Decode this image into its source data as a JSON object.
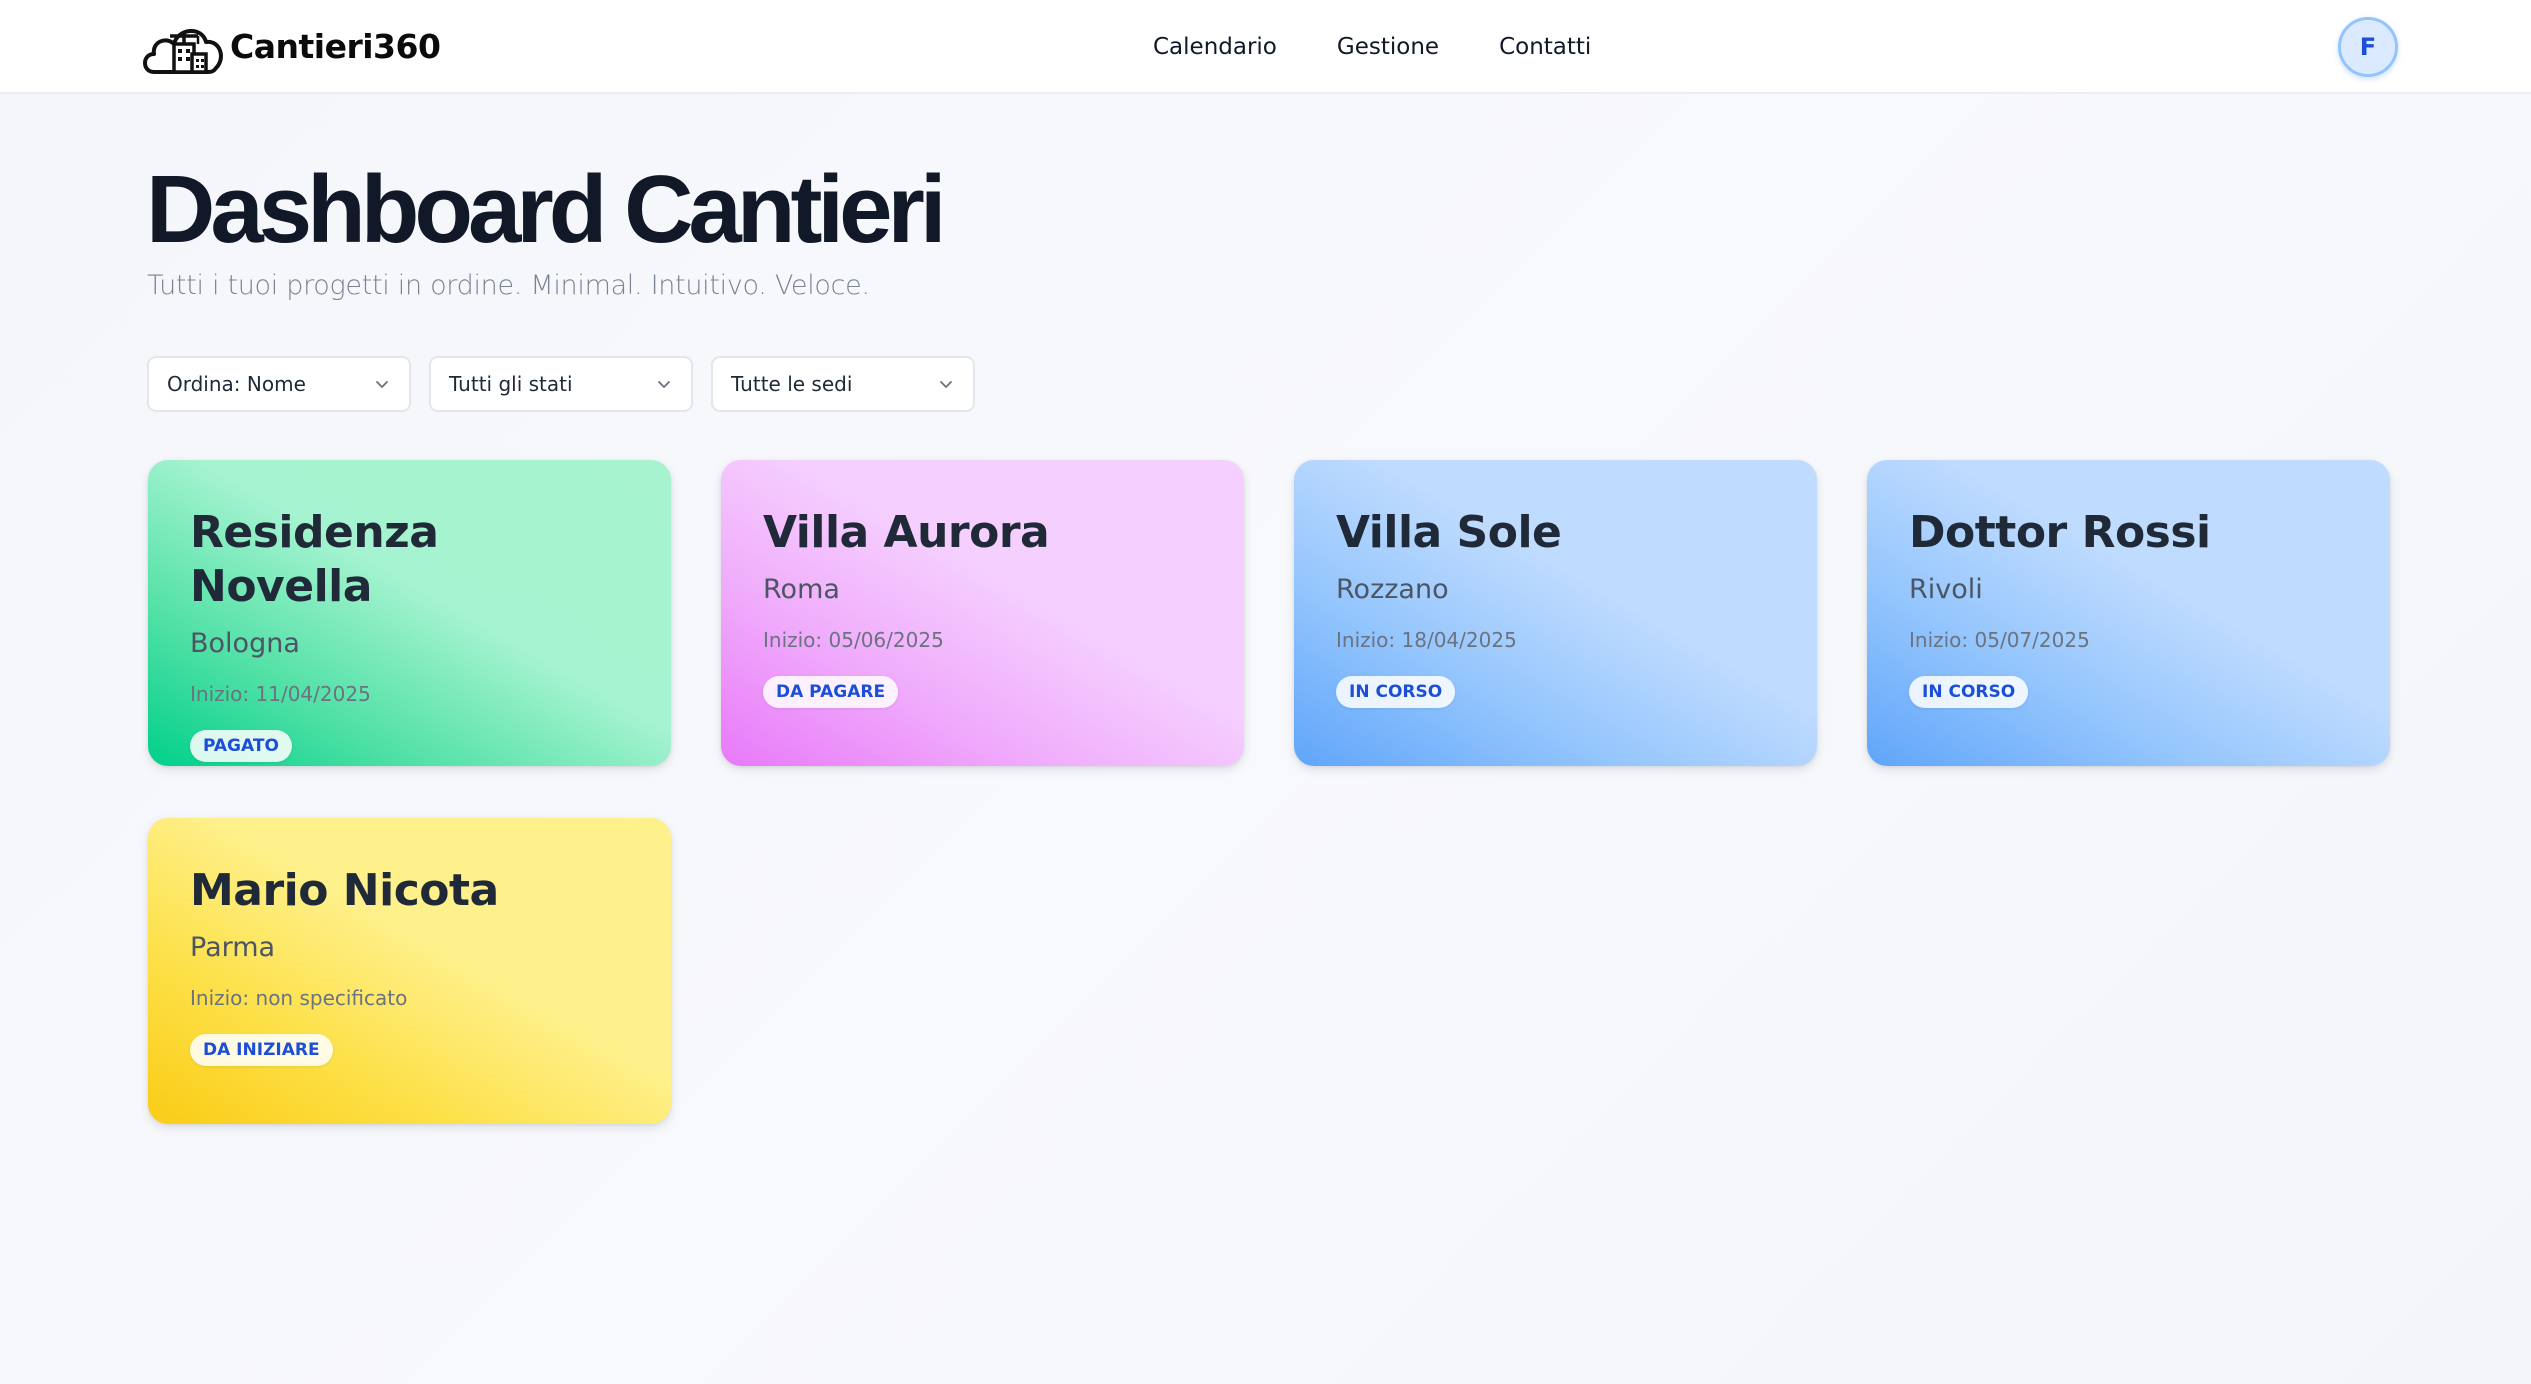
{
  "brand": {
    "name": "Cantieri360",
    "logo_icon": "cloud-building-icon"
  },
  "nav": {
    "links": [
      "Calendario",
      "Gestione",
      "Contatti"
    ]
  },
  "user": {
    "avatar_initial": "F"
  },
  "header": {
    "title": "Dashboard Cantieri",
    "subtitle": "Tutti i tuoi progetti in ordine. Minimal. Intuitivo. Veloce."
  },
  "filters": [
    {
      "label": "Ordina: Nome",
      "icon": "chevron-down-icon"
    },
    {
      "label": "Tutti gli stati",
      "icon": "chevron-down-icon"
    },
    {
      "label": "Tutte le sedi",
      "icon": "chevron-down-icon"
    }
  ],
  "projects": [
    {
      "name": "Residenza Novella",
      "city": "Bologna",
      "start": "Inizio: 11/04/2025",
      "status": "PAGATO",
      "color": "#a7f3d0"
    },
    {
      "name": "Villa Aurora",
      "city": "Roma",
      "start": "Inizio: 05/06/2025",
      "status": "DA PAGARE",
      "color": "#f5d0fe"
    },
    {
      "name": "Villa Sole",
      "city": "Rozzano",
      "start": "Inizio: 18/04/2025",
      "status": "IN CORSO",
      "color": "#bfdbfe"
    },
    {
      "name": "Dottor Rossi",
      "city": "Rivoli",
      "start": "Inizio: 05/07/2025",
      "status": "IN CORSO",
      "color": "#bfdbfe"
    },
    {
      "name": "Mario Nicota",
      "city": "Parma",
      "start": "Inizio: non specificato",
      "status": "DA INIZIARE",
      "color": "#fef08a"
    }
  ],
  "colors": {
    "badge_text": "#1d4ed8",
    "title": "#111827",
    "accent": "#93c5fd"
  }
}
